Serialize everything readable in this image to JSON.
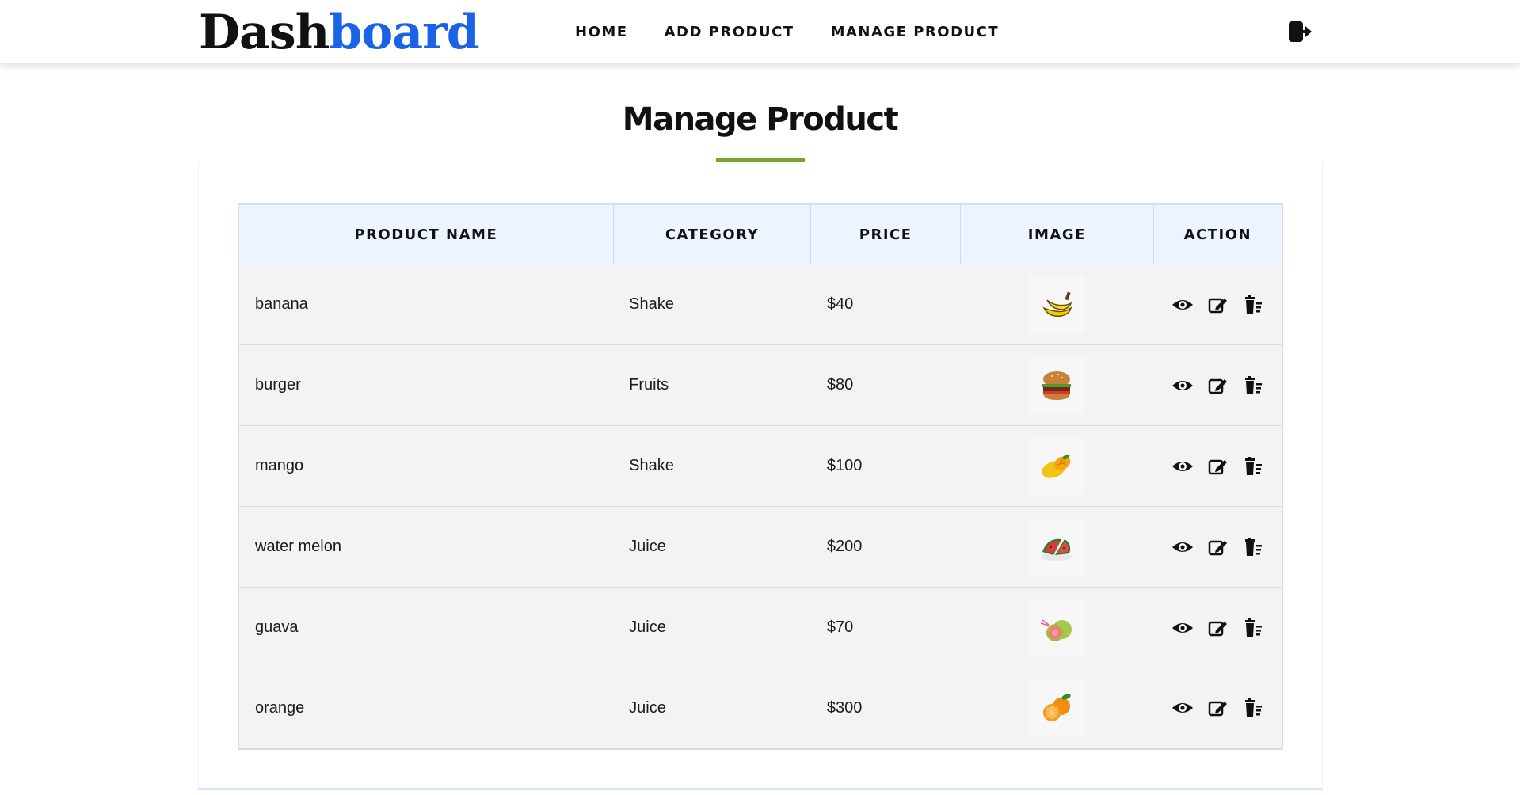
{
  "header": {
    "logo_dark": "Dash",
    "logo_blue": "board",
    "nav": [
      {
        "label": "HOME"
      },
      {
        "label": "ADD PRODUCT"
      },
      {
        "label": "MANAGE PRODUCT"
      }
    ],
    "logout_icon": "sign-out-icon"
  },
  "main": {
    "title": "Manage Product",
    "accent_color": "#7ba22e",
    "brand_blue": "#1a63e6",
    "table": {
      "columns": [
        "PRODUCT NAME",
        "CATEGORY",
        "PRICE",
        "IMAGE",
        "ACTION"
      ],
      "rows": [
        {
          "name": "banana",
          "category": "Shake",
          "price": "$40",
          "image_icon": "banana-image"
        },
        {
          "name": "burger",
          "category": "Fruits",
          "price": "$80",
          "image_icon": "burger-image"
        },
        {
          "name": "mango",
          "category": "Shake",
          "price": "$100",
          "image_icon": "mango-image"
        },
        {
          "name": "water melon",
          "category": "Juice",
          "price": "$200",
          "image_icon": "watermelon-image"
        },
        {
          "name": "guava",
          "category": "Juice",
          "price": "$70",
          "image_icon": "guava-image"
        },
        {
          "name": "orange",
          "category": "Juice",
          "price": "$300",
          "image_icon": "orange-image"
        }
      ],
      "actions": [
        "eye-icon",
        "edit-icon",
        "delete-icon"
      ]
    }
  }
}
